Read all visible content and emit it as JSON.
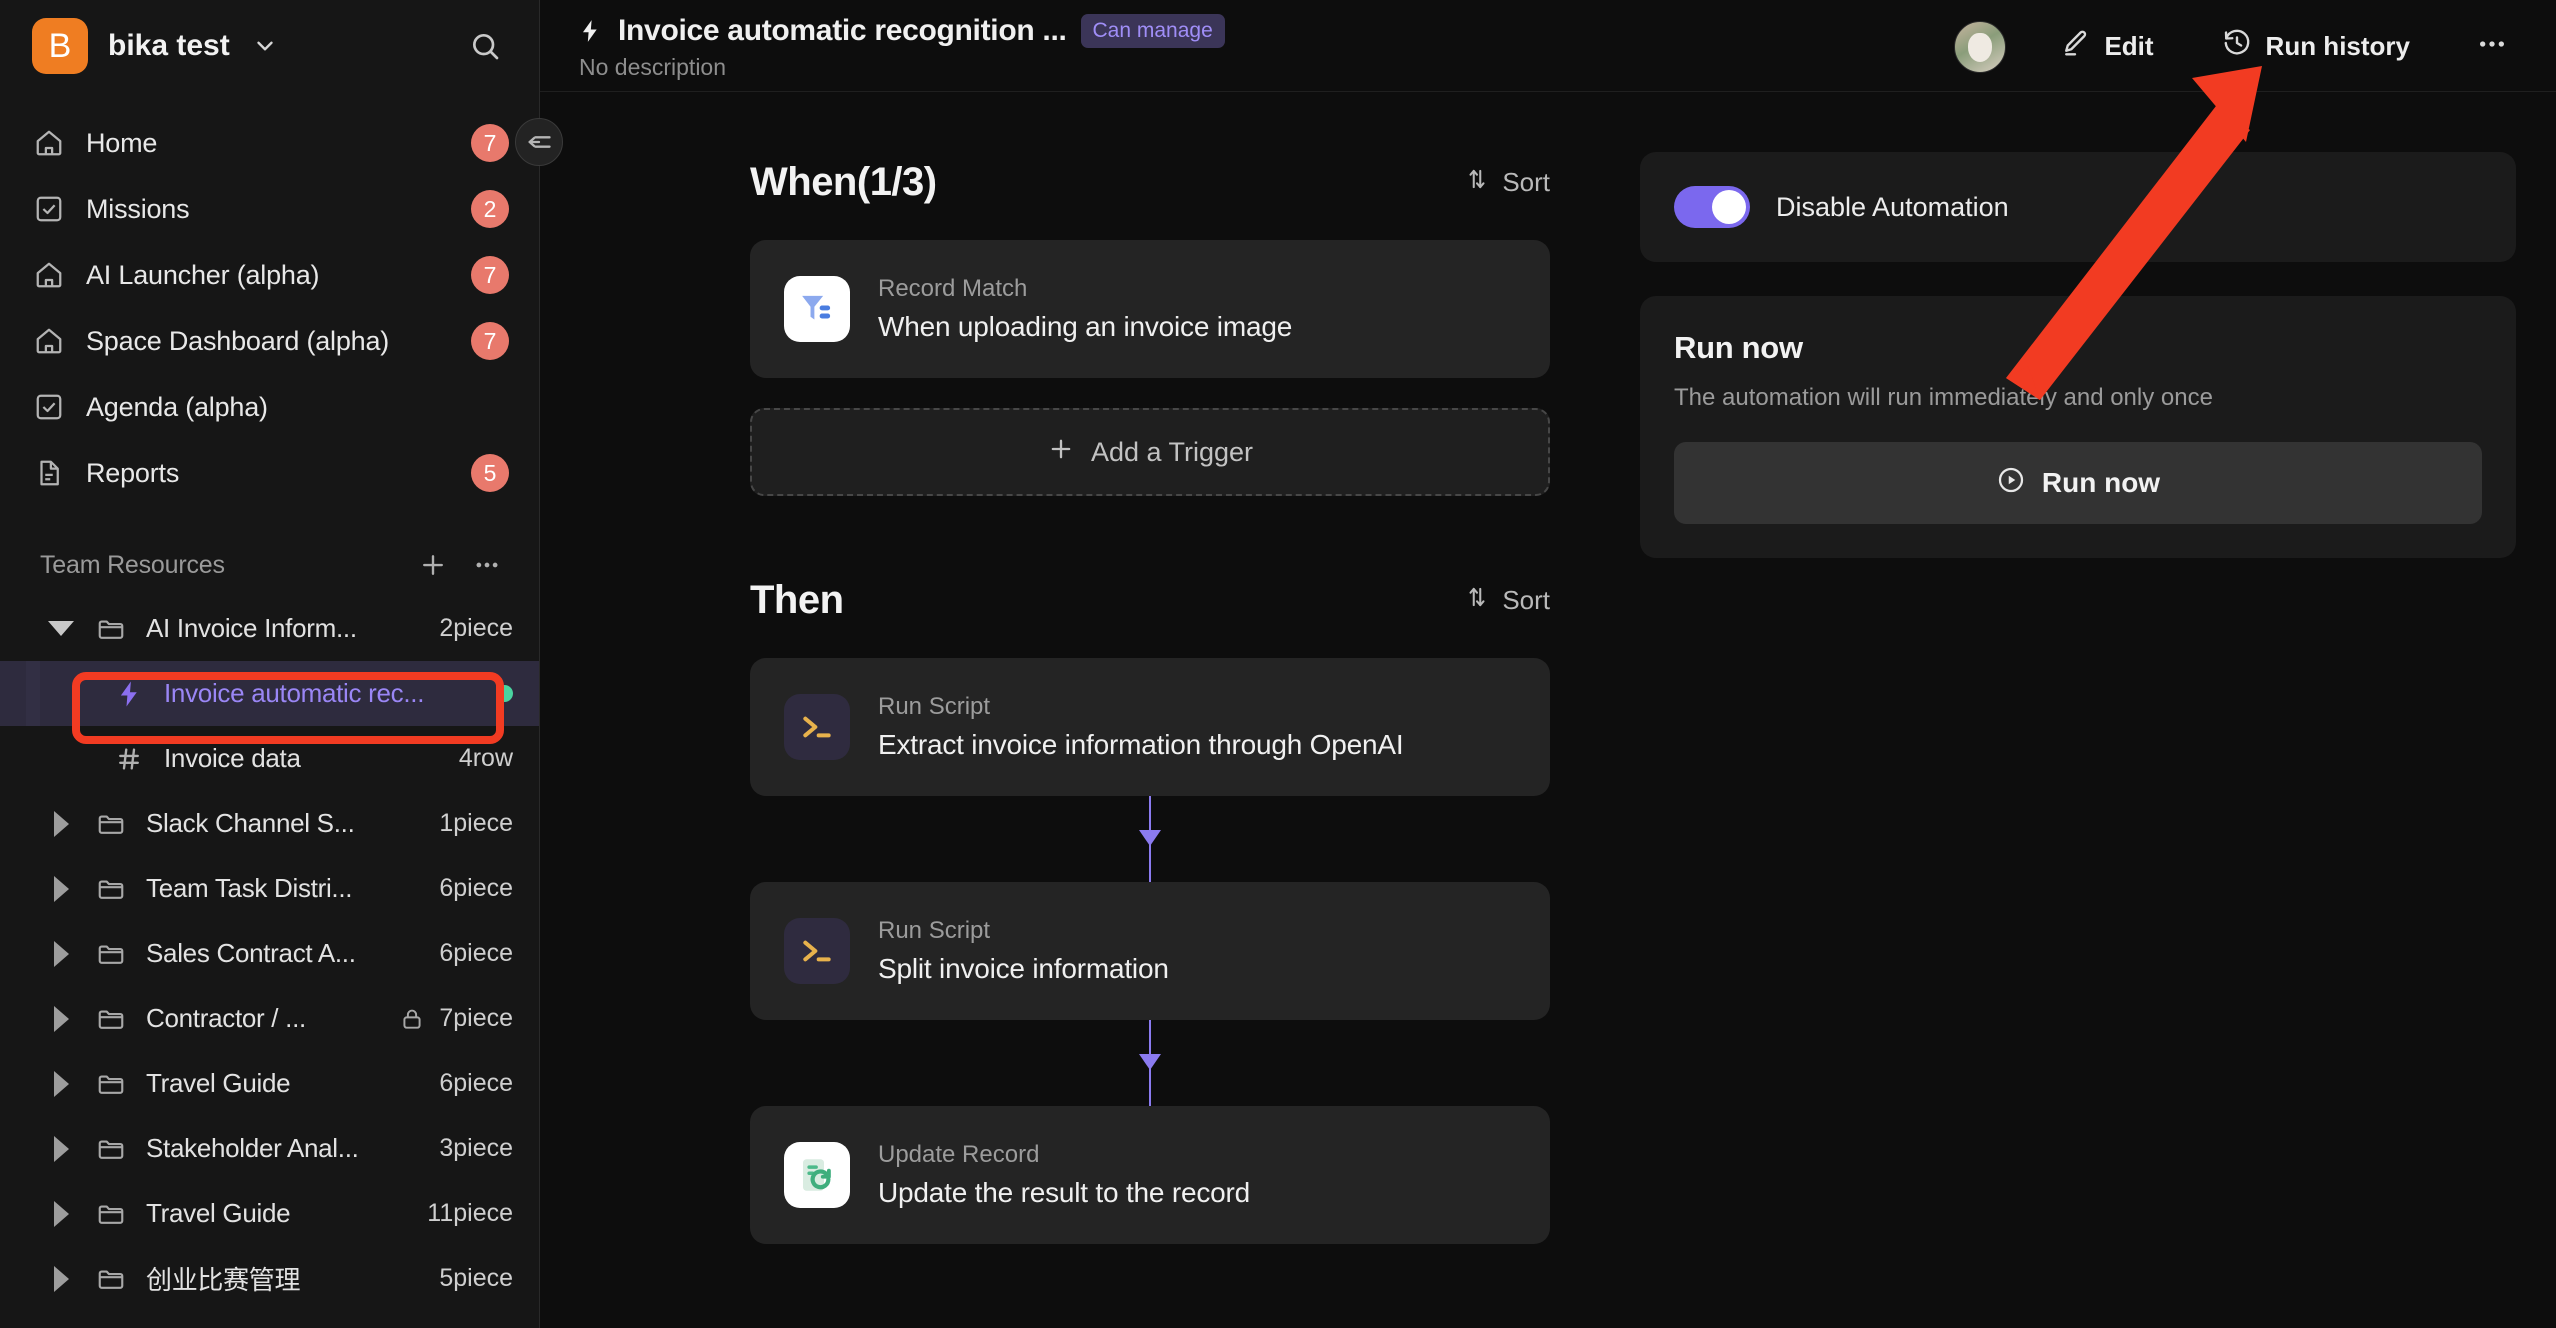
{
  "workspace": {
    "logo_letter": "B",
    "name": "bika test",
    "search_icon": "search-icon",
    "caret_icon": "chevron-down-icon"
  },
  "sidebar": {
    "nav": [
      {
        "label": "Home",
        "icon": "home-icon",
        "badge": "7"
      },
      {
        "label": "Missions",
        "icon": "checkbox-icon",
        "badge": "2"
      },
      {
        "label": "AI Launcher (alpha)",
        "icon": "home-icon",
        "badge": "7"
      },
      {
        "label": "Space Dashboard (alpha)",
        "icon": "home-icon",
        "badge": "7"
      },
      {
        "label": "Agenda (alpha)",
        "icon": "checkbox-icon",
        "badge": ""
      },
      {
        "label": "Reports",
        "icon": "document-icon",
        "badge": "5"
      }
    ],
    "section": {
      "title": "Team Resources",
      "add_icon": "plus-icon",
      "more_icon": "ellipsis-icon"
    },
    "tree": [
      {
        "label": "AI Invoice Inform...",
        "count": "2piece",
        "icon": "folder-icon",
        "twisty": "down",
        "indent": 1,
        "locked": false,
        "selected": false
      },
      {
        "label": "Invoice automatic rec...",
        "count": "",
        "icon": "bolt-icon",
        "twisty": "none",
        "indent": 2,
        "locked": false,
        "selected": true,
        "status_dot": true
      },
      {
        "label": "Invoice data",
        "count": "4row",
        "icon": "grid-icon",
        "twisty": "none",
        "indent": 2,
        "locked": false,
        "selected": false
      },
      {
        "label": "Slack Channel S...",
        "count": "1piece",
        "icon": "folder-icon",
        "twisty": "right",
        "indent": 1,
        "locked": false,
        "selected": false
      },
      {
        "label": "Team Task Distri...",
        "count": "6piece",
        "icon": "folder-icon",
        "twisty": "right",
        "indent": 1,
        "locked": false,
        "selected": false
      },
      {
        "label": "Sales Contract A...",
        "count": "6piece",
        "icon": "folder-icon",
        "twisty": "right",
        "indent": 1,
        "locked": false,
        "selected": false
      },
      {
        "label": "Contractor / ...",
        "count": "7piece",
        "icon": "folder-icon",
        "twisty": "right",
        "indent": 1,
        "locked": true,
        "selected": false
      },
      {
        "label": "Travel Guide",
        "count": "6piece",
        "icon": "folder-icon",
        "twisty": "right",
        "indent": 1,
        "locked": false,
        "selected": false
      },
      {
        "label": "Stakeholder Anal...",
        "count": "3piece",
        "icon": "folder-icon",
        "twisty": "right",
        "indent": 1,
        "locked": false,
        "selected": false
      },
      {
        "label": "Travel Guide",
        "count": "11piece",
        "icon": "folder-icon",
        "twisty": "right",
        "indent": 1,
        "locked": false,
        "selected": false
      },
      {
        "label": "创业比赛管理",
        "count": "5piece",
        "icon": "folder-icon",
        "twisty": "right",
        "indent": 1,
        "locked": false,
        "selected": false
      }
    ],
    "collapse_icon": "collapse-sidebar-icon"
  },
  "header": {
    "bolt_icon": "bolt-icon",
    "title": "Invoice automatic recognition ...",
    "permission_badge": "Can manage",
    "description": "No description",
    "avatar": "user-avatar",
    "edit_label": "Edit",
    "edit_icon": "pencil-icon",
    "run_history_label": "Run history",
    "run_history_icon": "history-icon",
    "more_icon": "ellipsis-icon"
  },
  "flow": {
    "when": {
      "title": "When(1/3)",
      "sort_label": "Sort",
      "sort_icon": "sort-icon",
      "cards": [
        {
          "kind": "Record Match",
          "name": "When uploading an invoice image",
          "icon": "filter-icon"
        }
      ],
      "add_trigger_label": "Add a Trigger",
      "add_trigger_icon": "plus-icon"
    },
    "then": {
      "title": "Then",
      "sort_label": "Sort",
      "sort_icon": "sort-icon",
      "cards": [
        {
          "kind": "Run Script",
          "name": "Extract invoice information through OpenAI",
          "icon": "terminal-icon"
        },
        {
          "kind": "Run Script",
          "name": "Split invoice information",
          "icon": "terminal-icon"
        },
        {
          "kind": "Update Record",
          "name": "Update the result to the record",
          "icon": "update-record-icon"
        }
      ]
    }
  },
  "right_panel": {
    "disable_automation_label": "Disable Automation",
    "toggle_state": "on",
    "run_now_title": "Run now",
    "run_now_desc": "The automation will run immediately and only once",
    "run_now_button": "Run now",
    "run_now_icon": "play-circle-icon"
  },
  "colors": {
    "accent_purple": "#7b68ee",
    "brand_orange": "#ef7d22",
    "badge_red": "#e8796c",
    "annotation_red": "#f23b22",
    "status_green": "#4ad4a0"
  }
}
